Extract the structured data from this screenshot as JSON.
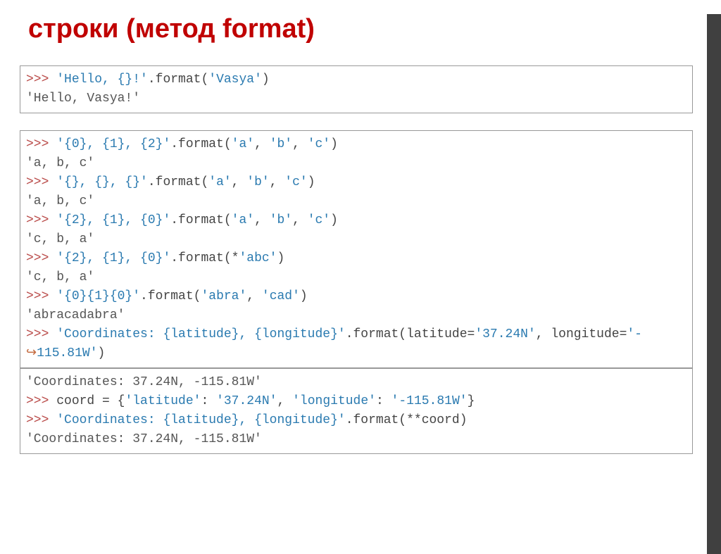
{
  "title": "строки (метод format)",
  "box1": {
    "l1_prompt": ">>> ",
    "l1_str1": "'Hello, {}!'",
    "l1_plain": ".format(",
    "l1_str2": "'Vasya'",
    "l1_end": ")",
    "l2_out": "'Hello, Vasya!'"
  },
  "box2": {
    "r1_prompt": ">>> ",
    "r1_s": "'{0}, {1}, {2}'",
    "r1_p1": ".format(",
    "r1_a1": "'a'",
    "r1_c1": ", ",
    "r1_a2": "'b'",
    "r1_c2": ", ",
    "r1_a3": "'c'",
    "r1_end": ")",
    "r1_out": "'a, b, c'",
    "r2_prompt": ">>> ",
    "r2_s": "'{}, {}, {}'",
    "r2_p1": ".format(",
    "r2_a1": "'a'",
    "r2_c1": ", ",
    "r2_a2": "'b'",
    "r2_c2": ", ",
    "r2_a3": "'c'",
    "r2_end": ")",
    "r2_out": "'a, b, c'",
    "r3_prompt": ">>> ",
    "r3_s": "'{2}, {1}, {0}'",
    "r3_p1": ".format(",
    "r3_a1": "'a'",
    "r3_c1": ", ",
    "r3_a2": "'b'",
    "r3_c2": ", ",
    "r3_a3": "'c'",
    "r3_end": ")",
    "r3_out": "'c, b, a'",
    "r4_prompt": ">>> ",
    "r4_s": "'{2}, {1}, {0}'",
    "r4_p1": ".format(*",
    "r4_a1": "'abc'",
    "r4_end": ")",
    "r4_out": "'c, b, a'",
    "r5_prompt": ">>> ",
    "r5_s": "'{0}{1}{0}'",
    "r5_p1": ".format(",
    "r5_a1": "'abra'",
    "r5_c1": ", ",
    "r5_a2": "'cad'",
    "r5_end": ")",
    "r5_out": "'abracadabra'",
    "r6_prompt": ">>> ",
    "r6_s": "'Coordinates: {latitude}, {longitude}'",
    "r6_p1": ".format(latitude=",
    "r6_a1": "'37.24N'",
    "r6_c1": ", longitude=",
    "r6_a2": "'-",
    "r6_arrow": "↪",
    "r6_cont": "115.81W'",
    "r6_end": ")"
  },
  "box3": {
    "out1": "'Coordinates: 37.24N, -115.81W'",
    "p2_prompt": ">>> ",
    "p2_plain1": "coord = {",
    "p2_k1": "'latitude'",
    "p2_sep1": ": ",
    "p2_v1": "'37.24N'",
    "p2_c1": ", ",
    "p2_k2": "'longitude'",
    "p2_sep2": ": ",
    "p2_v2": "'-115.81W'",
    "p2_end": "}",
    "p3_prompt": ">>> ",
    "p3_s": "'Coordinates: {latitude}, {longitude}'",
    "p3_p1": ".format(**coord)",
    "out2": "'Coordinates: 37.24N, -115.81W'"
  }
}
